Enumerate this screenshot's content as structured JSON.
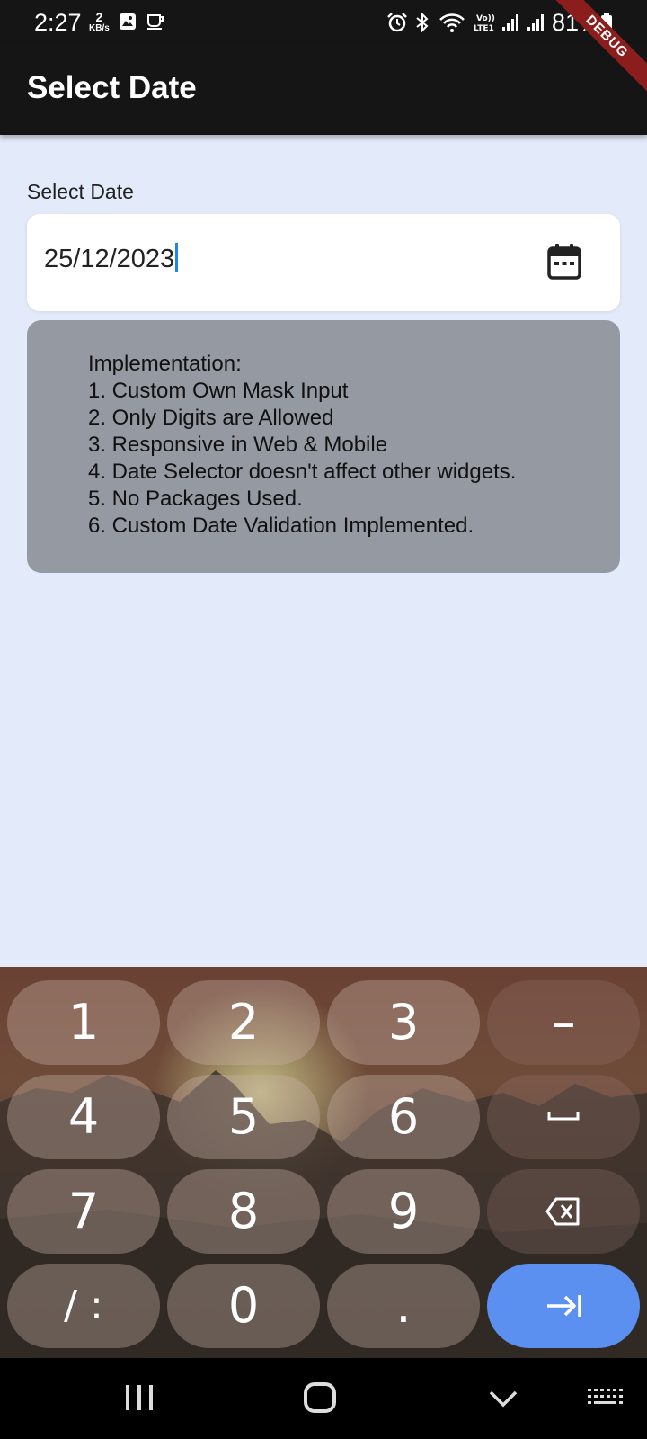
{
  "status_bar": {
    "time": "2:27",
    "net_speed_value": "2",
    "net_speed_unit": "KB/s",
    "battery": "81%",
    "icons": [
      "gallery-icon",
      "coffee-icon",
      "alarm-icon",
      "bluetooth-icon",
      "wifi-icon",
      "volte-icon",
      "signal-icon",
      "signal-icon",
      "battery-icon"
    ]
  },
  "debug_banner": "DEBUG",
  "app_bar": {
    "title": "Select Date"
  },
  "date_field": {
    "label": "Select Date",
    "value": "25/12/2023",
    "icon": "calendar-icon"
  },
  "info": {
    "lines": [
      "Implementation:",
      "1. Custom Own Mask Input",
      "2. Only Digits are Allowed",
      "3. Responsive in Web & Mobile",
      "4. Date Selector doesn't affect other widgets.",
      "5. No Packages Used.",
      "6. Custom Date Validation Implemented."
    ]
  },
  "keyboard": {
    "keys": {
      "k1": "1",
      "k2": "2",
      "k3": "3",
      "minus": "–",
      "k4": "4",
      "k5": "5",
      "k6": "6",
      "space": "␣",
      "k7": "7",
      "k8": "8",
      "k9": "9",
      "slash_colon": "/ :",
      "k0": "0",
      "period": "."
    },
    "icons": [
      "backspace-icon",
      "tab-enter-icon"
    ],
    "colors": {
      "enter": "#5b8ff0"
    }
  },
  "nav_bar": {
    "icons": [
      "recents-icon",
      "home-icon",
      "back-icon",
      "keyboard-switch-icon"
    ]
  }
}
